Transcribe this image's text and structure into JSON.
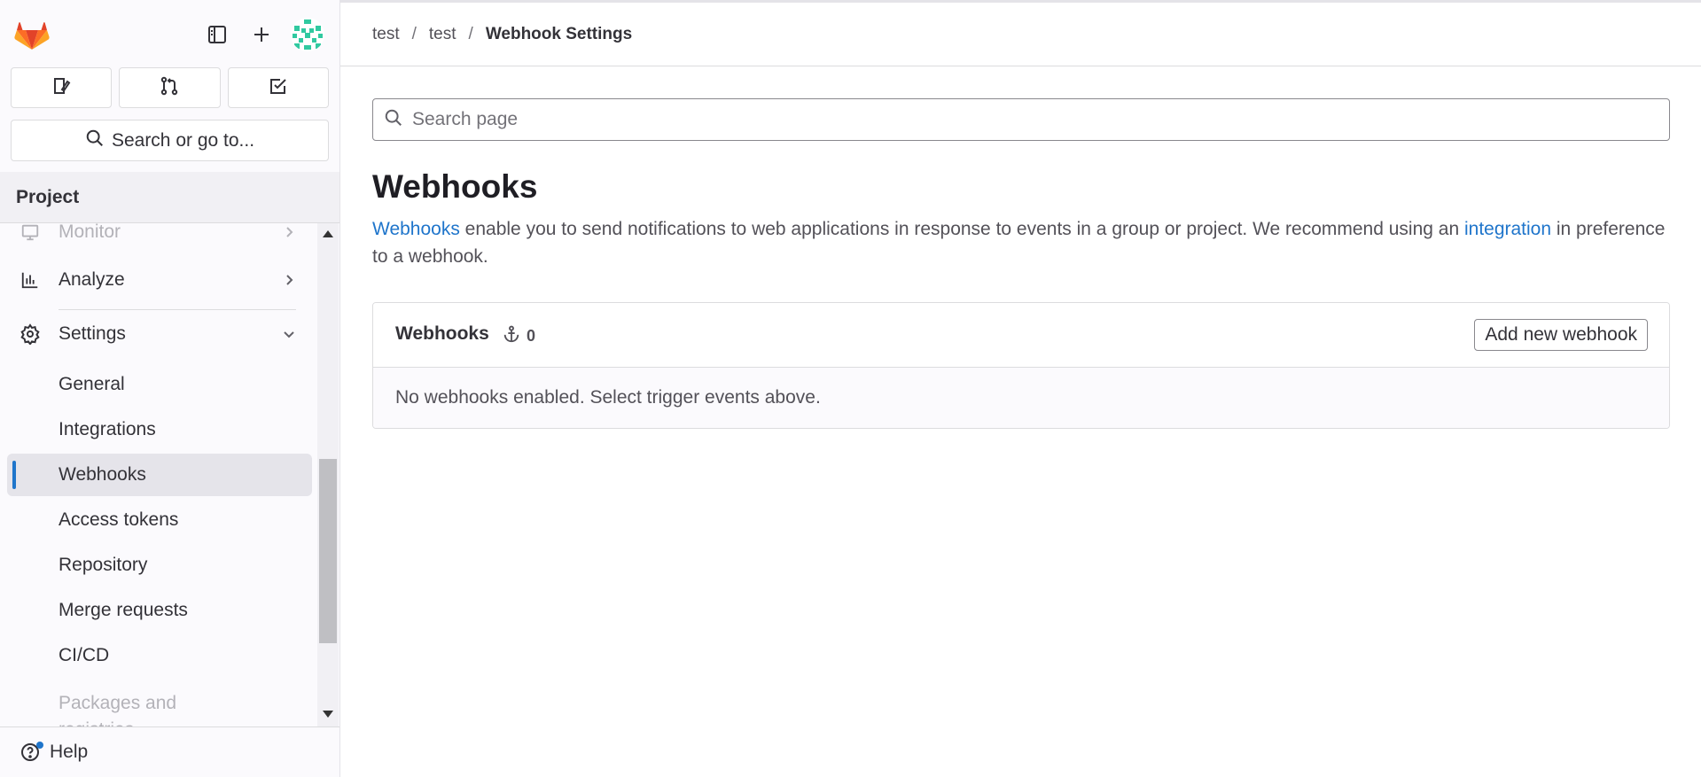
{
  "sidebar": {
    "top_icons": [
      "gitlab-logo",
      "sidebar-toggle-icon",
      "plus-icon",
      "avatar"
    ],
    "quick_buttons": [
      "issues-icon",
      "merge-request-icon",
      "todo-icon"
    ],
    "search_label": "Search or go to...",
    "section_title": "Project",
    "nav": {
      "monitor": "Monitor",
      "analyze": "Analyze",
      "settings": "Settings",
      "general": "General",
      "integrations": "Integrations",
      "webhooks": "Webhooks",
      "access_tokens": "Access tokens",
      "repository": "Repository",
      "merge_requests": "Merge requests",
      "cicd": "CI/CD",
      "packages": "Packages and registries"
    },
    "help_label": "Help"
  },
  "breadcrumb": {
    "items": [
      "test",
      "test",
      "Webhook Settings"
    ],
    "separator": "/"
  },
  "search": {
    "placeholder": "Search page"
  },
  "main": {
    "title": "Webhooks",
    "desc_link_1": "Webhooks",
    "desc_text_1": " enable you to send notifications to web applications in response to events in a group or project. We recommend using an ",
    "desc_link_2": "integration",
    "desc_text_2": " in preference to a webhook."
  },
  "card": {
    "title": "Webhooks",
    "count": "0",
    "add_button": "Add new webhook",
    "empty_message": "No webhooks enabled. Select trigger events above."
  },
  "colors": {
    "accent": "#1f75cb",
    "logo_orange": "#fc6d26",
    "logo_red": "#e24329",
    "logo_amber": "#fca326"
  }
}
